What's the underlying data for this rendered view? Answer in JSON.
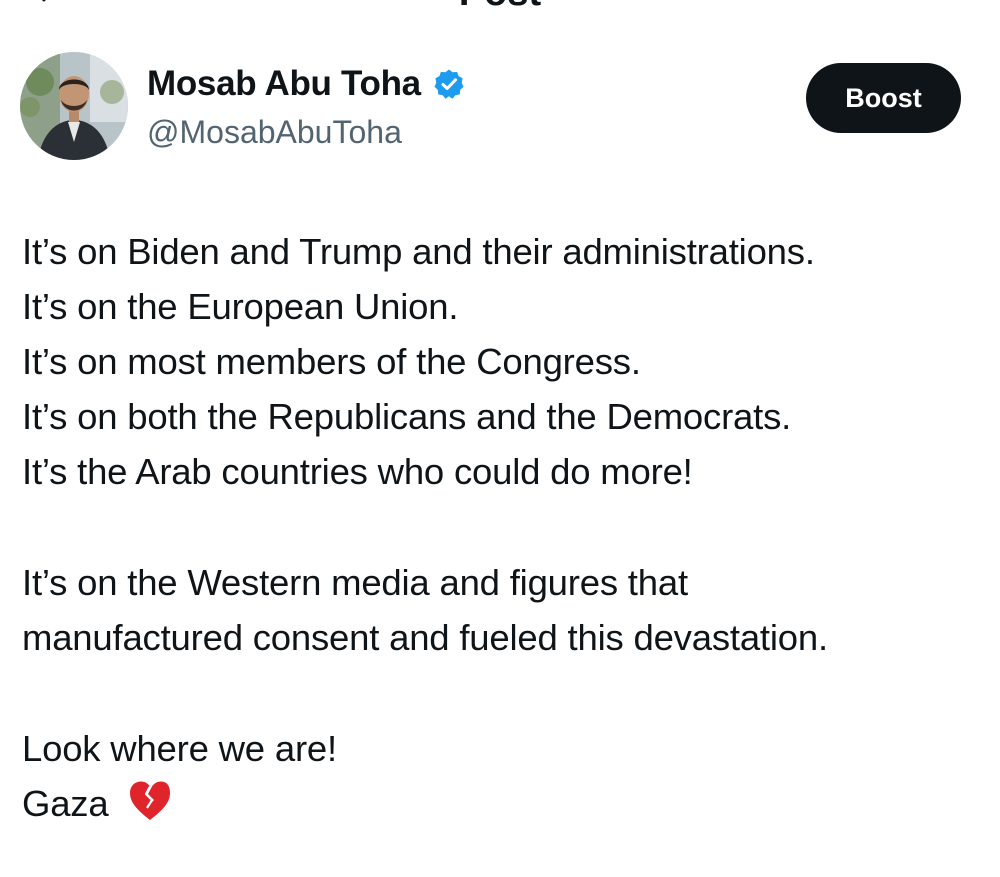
{
  "topbar": {
    "title": "Post"
  },
  "author": {
    "name": "Mosab Abu Toha",
    "handle": "@MosabAbuToha",
    "verified": true
  },
  "actions": {
    "boost_label": "Boost"
  },
  "post": {
    "paragraph1": [
      "It’s on Biden and Trump and their administrations.",
      "It’s on the European Union.",
      "It’s on most members of the Congress.",
      "It’s on both the Republicans and the Democrats.",
      "It’s the Arab countries who could do more!"
    ],
    "paragraph2": [
      "It’s on the Western media and figures that",
      "manufactured consent and fueled this devastation."
    ],
    "paragraph3": [
      "Look where we are!",
      "Gaza"
    ],
    "emoji": "broken-heart-icon"
  },
  "colors": {
    "text": "#0f1419",
    "secondary": "#536471",
    "verified_badge": "#1d9bf0",
    "button_bg": "#0f1419",
    "heart": "#e0242c"
  }
}
